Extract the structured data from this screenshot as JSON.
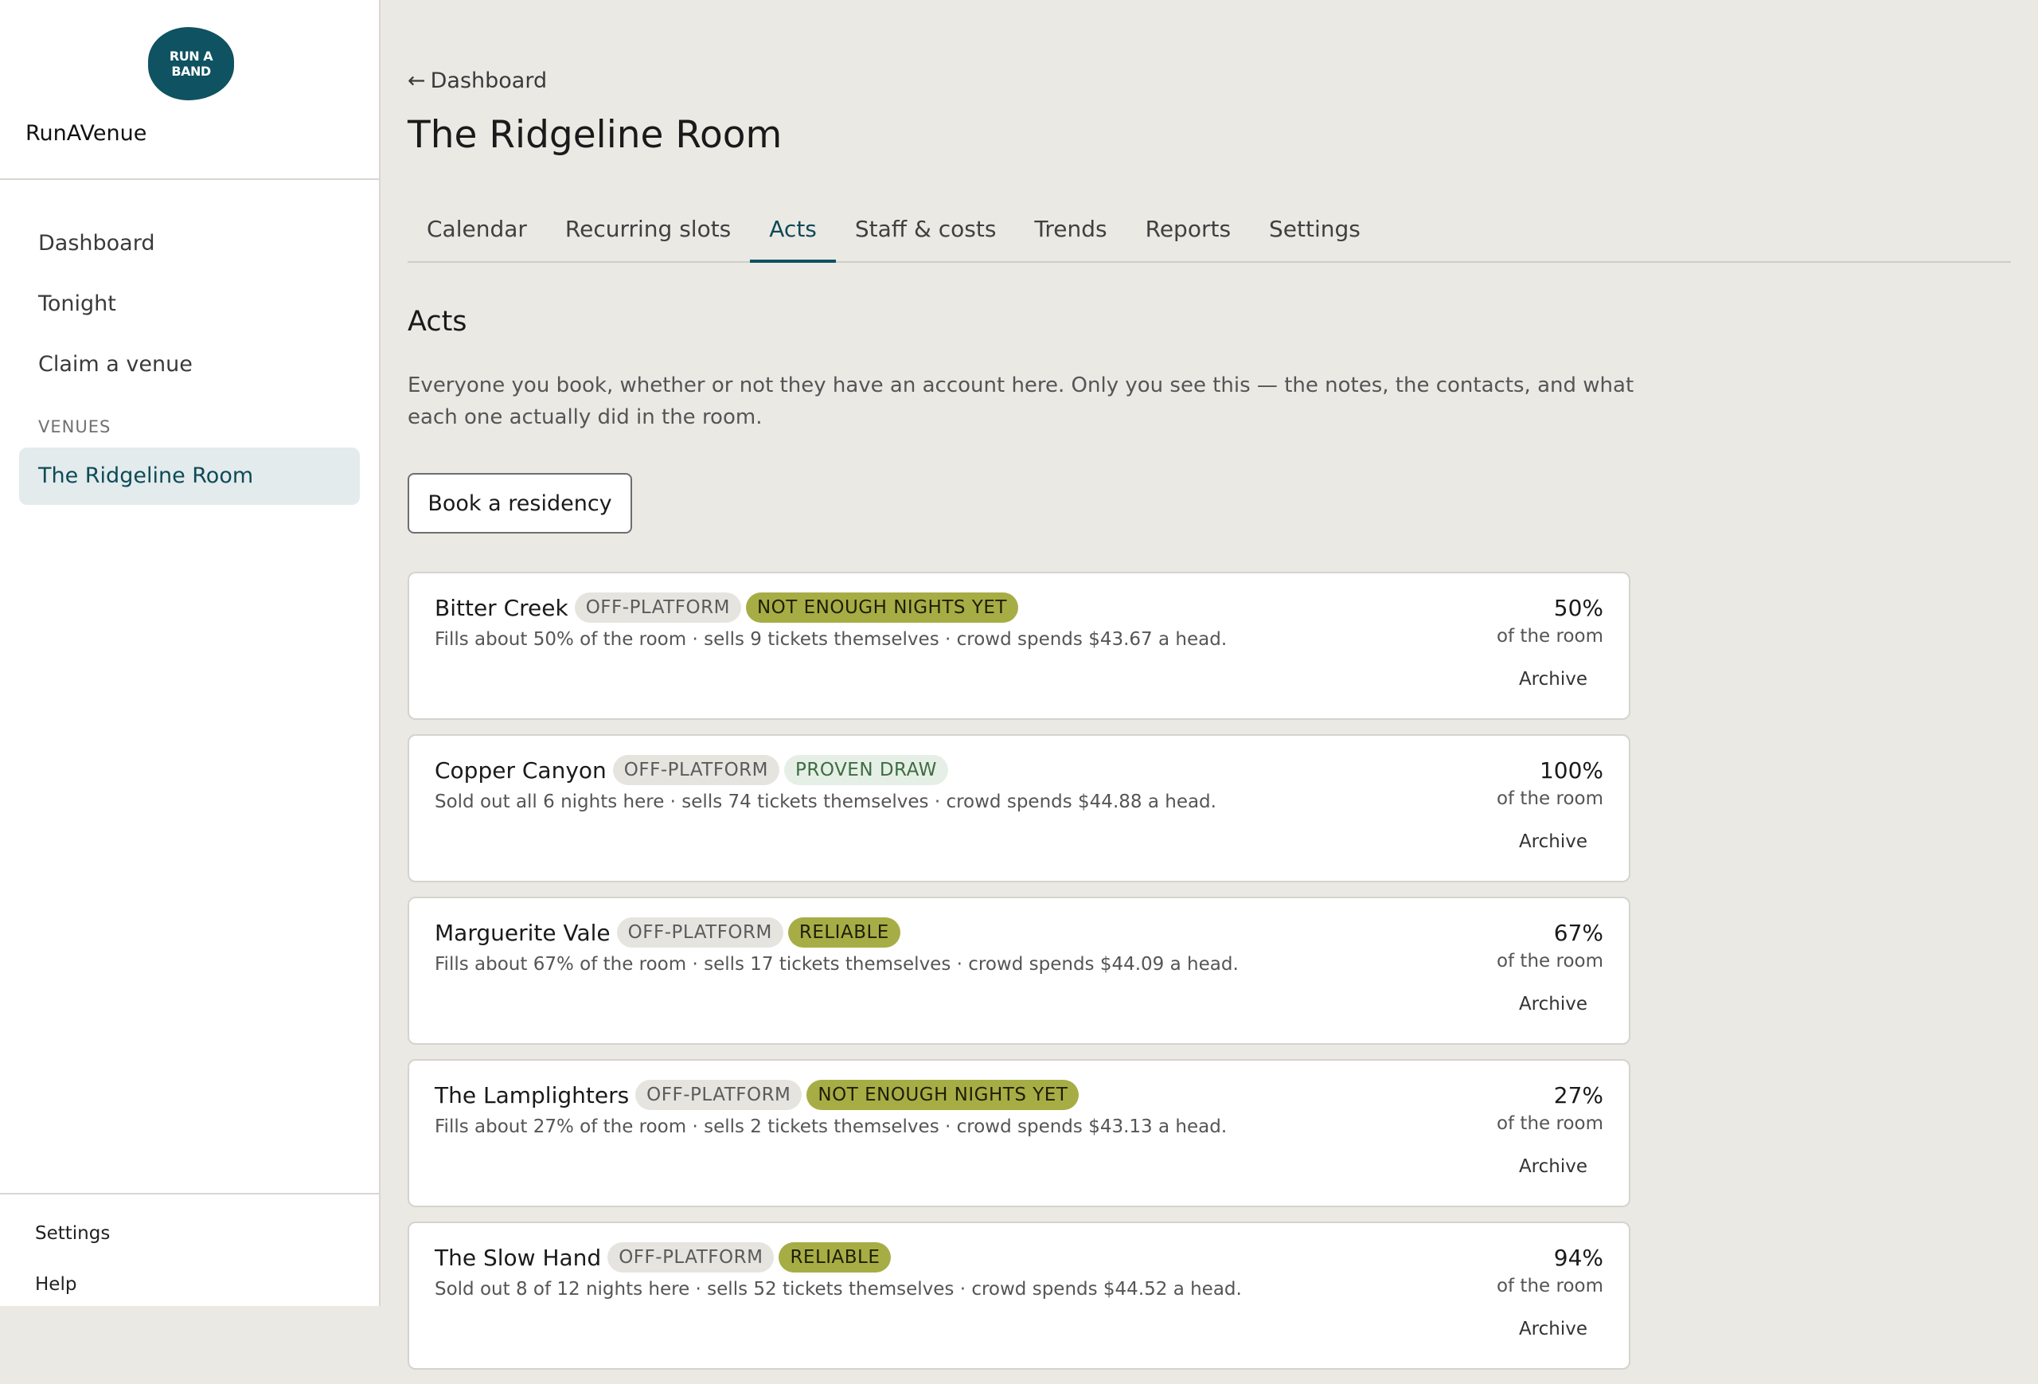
{
  "brand": {
    "logo_text": "RUN A BAND",
    "name": "RunAVenue"
  },
  "sidebar": {
    "items": [
      {
        "label": "Dashboard"
      },
      {
        "label": "Tonight"
      },
      {
        "label": "Claim a venue"
      }
    ],
    "section_label": "VENUES",
    "venue": "The Ridgeline Room",
    "footer": {
      "settings": "Settings",
      "help": "Help"
    }
  },
  "header": {
    "back_arrow": "←",
    "back_label": "Dashboard",
    "title": "The Ridgeline Room"
  },
  "tabs": [
    {
      "label": "Calendar"
    },
    {
      "label": "Recurring slots"
    },
    {
      "label": "Acts",
      "active": true
    },
    {
      "label": "Staff & costs"
    },
    {
      "label": "Trends"
    },
    {
      "label": "Reports"
    },
    {
      "label": "Settings"
    }
  ],
  "section": {
    "title": "Acts",
    "description": "Everyone you book, whether or not they have an account here. Only you see this — the notes, the contacts, and what each one actually did in the room.",
    "book_button": "Book a residency"
  },
  "acts": [
    {
      "name": "Bitter Creek",
      "badge1": "OFF-PLATFORM",
      "badge2": "NOT ENOUGH NIGHTS YET",
      "summary": "Fills about 50% of the room · sells 9 tickets themselves · crowd spends $43.67 a head.",
      "pct": "50%",
      "pct_label": "of the room",
      "archive": "Archive"
    },
    {
      "name": "Copper Canyon",
      "badge1": "OFF-PLATFORM",
      "badge2": "PROVEN DRAW",
      "summary": "Sold out all 6 nights here · sells 74 tickets themselves · crowd spends $44.88 a head.",
      "pct": "100%",
      "pct_label": "of the room",
      "archive": "Archive"
    },
    {
      "name": "Marguerite Vale",
      "badge1": "OFF-PLATFORM",
      "badge2": "RELIABLE",
      "summary": "Fills about 67% of the room · sells 17 tickets themselves · crowd spends $44.09 a head.",
      "pct": "67%",
      "pct_label": "of the room",
      "archive": "Archive"
    },
    {
      "name": "The Lamplighters",
      "badge1": "OFF-PLATFORM",
      "badge2": "NOT ENOUGH NIGHTS YET",
      "summary": "Fills about 27% of the room · sells 2 tickets themselves · crowd spends $43.13 a head.",
      "pct": "27%",
      "pct_label": "of the room",
      "archive": "Archive"
    },
    {
      "name": "The Slow Hand",
      "badge1": "OFF-PLATFORM",
      "badge2": "RELIABLE",
      "summary": "Sold out 8 of 12 nights here · sells 52 tickets themselves · crowd spends $44.52 a head.",
      "pct": "94%",
      "pct_label": "of the room",
      "archive": "Archive"
    }
  ],
  "colors": {
    "accent": "#0f5261",
    "olive_badge": "#a7ad45",
    "proven_badge": "#e6efe6"
  }
}
